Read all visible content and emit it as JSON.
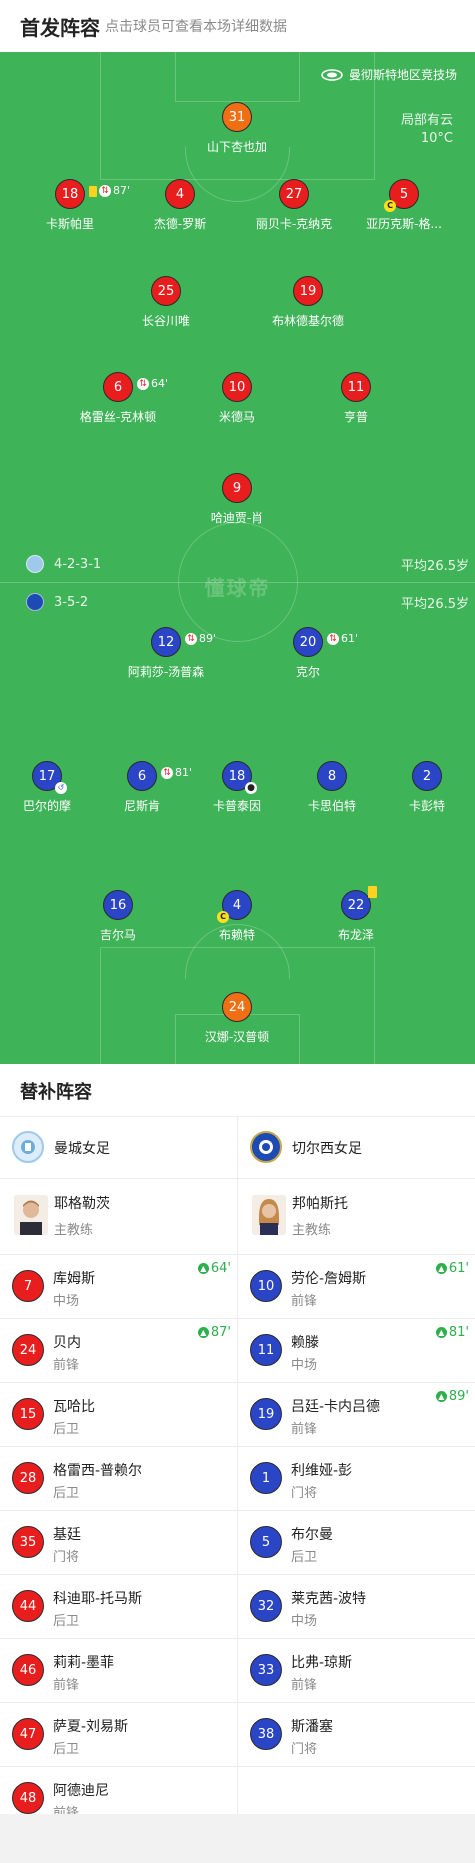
{
  "header": {
    "title": "首发阵容",
    "subtitle": "点击球员可查看本场详细数据"
  },
  "pitch": {
    "venue": "曼彻斯特地区竞技场",
    "weather": [
      "局部有云",
      "10°C"
    ],
    "watermark": "懂球帝",
    "home_formation": "4-2-3-1",
    "away_formation": "3-5-2",
    "home_avg_age": "平均26.5岁",
    "away_avg_age": "平均26.5岁",
    "players": [
      {
        "num": "31",
        "name": "山下杏也加",
        "color": "orange"
      },
      {
        "num": "18",
        "name": "卡斯帕里",
        "color": "red",
        "event": "87'"
      },
      {
        "num": "4",
        "name": "杰德-罗斯",
        "color": "red"
      },
      {
        "num": "27",
        "name": "丽贝卡-克纳克",
        "color": "red"
      },
      {
        "num": "5",
        "name": "亚历克斯-格...",
        "color": "red"
      },
      {
        "num": "25",
        "name": "长谷川唯",
        "color": "red"
      },
      {
        "num": "19",
        "name": "布林德基尔德",
        "color": "red"
      },
      {
        "num": "6",
        "name": "格雷丝-克林顿",
        "color": "red",
        "event": "64'"
      },
      {
        "num": "10",
        "name": "米德马",
        "color": "red"
      },
      {
        "num": "11",
        "name": "亨普",
        "color": "red"
      },
      {
        "num": "9",
        "name": "哈迪贾-肖",
        "color": "red"
      },
      {
        "num": "12",
        "name": "阿莉莎-汤普森",
        "color": "blue",
        "event": "89'"
      },
      {
        "num": "20",
        "name": "克尔",
        "color": "blue",
        "event": "61'"
      },
      {
        "num": "17",
        "name": "巴尔的摩",
        "color": "blue"
      },
      {
        "num": "6",
        "name": "尼斯肯",
        "color": "blue",
        "event": "81'"
      },
      {
        "num": "18",
        "name": "卡普泰因",
        "color": "blue"
      },
      {
        "num": "8",
        "name": "卡思伯特",
        "color": "blue"
      },
      {
        "num": "2",
        "name": "卡彭特",
        "color": "blue"
      },
      {
        "num": "16",
        "name": "吉尔马",
        "color": "blue"
      },
      {
        "num": "4",
        "name": "布赖特",
        "color": "blue"
      },
      {
        "num": "22",
        "name": "布龙泽",
        "color": "blue"
      },
      {
        "num": "24",
        "name": "汉娜-汉普顿",
        "color": "orange"
      }
    ]
  },
  "subs": {
    "title": "替补阵容",
    "home": {
      "team": "曼城女足",
      "coach": {
        "name": "耶格勒茨",
        "role": "主教练"
      },
      "players": [
        {
          "num": "7",
          "name": "库姆斯",
          "pos": "中场",
          "min": "64'"
        },
        {
          "num": "24",
          "name": "贝内",
          "pos": "前锋",
          "min": "87'"
        },
        {
          "num": "15",
          "name": "瓦哈比",
          "pos": "后卫"
        },
        {
          "num": "28",
          "name": "格雷西-普赖尔",
          "pos": "后卫"
        },
        {
          "num": "35",
          "name": "基廷",
          "pos": "门将"
        },
        {
          "num": "44",
          "name": "科迪耶-托马斯",
          "pos": "后卫"
        },
        {
          "num": "46",
          "name": "莉莉-墨菲",
          "pos": "前锋"
        },
        {
          "num": "47",
          "name": "萨夏-刘易斯",
          "pos": "后卫"
        },
        {
          "num": "48",
          "name": "阿德迪尼",
          "pos": "前锋"
        }
      ]
    },
    "away": {
      "team": "切尔西女足",
      "coach": {
        "name": "邦帕斯托",
        "role": "主教练"
      },
      "players": [
        {
          "num": "10",
          "name": "劳伦-詹姆斯",
          "pos": "前锋",
          "min": "61'"
        },
        {
          "num": "11",
          "name": "赖滕",
          "pos": "中场",
          "min": "81'"
        },
        {
          "num": "19",
          "name": "吕廷-卡内吕德",
          "pos": "前锋",
          "min": "89'"
        },
        {
          "num": "1",
          "name": "利维娅-彭",
          "pos": "门将"
        },
        {
          "num": "5",
          "name": "布尔曼",
          "pos": "后卫"
        },
        {
          "num": "32",
          "name": "莱克茜-波特",
          "pos": "中场"
        },
        {
          "num": "33",
          "name": "比弗-琼斯",
          "pos": "前锋"
        },
        {
          "num": "38",
          "name": "斯潘塞",
          "pos": "门将"
        }
      ]
    }
  }
}
